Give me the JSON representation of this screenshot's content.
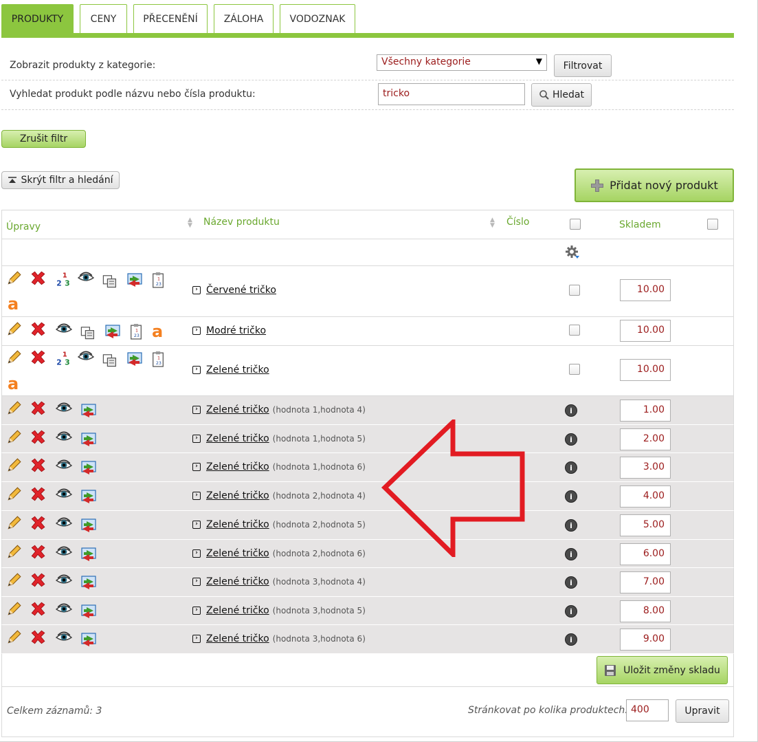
{
  "tabs": [
    {
      "label": "PRODUKTY",
      "active": true
    },
    {
      "label": "CENY",
      "active": false
    },
    {
      "label": "PŘECENĚNÍ",
      "active": false
    },
    {
      "label": "ZÁLOHA",
      "active": false
    },
    {
      "label": "VODOZNAK",
      "active": false
    }
  ],
  "filter": {
    "category_label": "Zobrazit produkty z kategorie:",
    "category_selected": "Všechny kategorie",
    "filter_button": "Filtrovat",
    "search_label": "Vyhledat produkt podle názvu nebo čísla produktu:",
    "search_value": "tricko",
    "search_button": "Hledat",
    "clear_button": "Zrušit filtr",
    "hide_button": "Skrýt filtr a hledání"
  },
  "add_product_button": "Přidat nový produkt",
  "table": {
    "headers": {
      "edits": "Úpravy",
      "name": "Název produktu",
      "number": "Číslo",
      "stock": "Skladem"
    },
    "rows": [
      {
        "name": "Červené tričko",
        "attr": "",
        "stock": "10.00",
        "variant": false
      },
      {
        "name": "Modré tričko",
        "attr": "",
        "stock": "10.00",
        "variant": false
      },
      {
        "name": "Zelené tričko",
        "attr": "",
        "stock": "10.00",
        "variant": false
      },
      {
        "name": "Zelené tričko",
        "attr": "(hodnota 1,hodnota 4)",
        "stock": "1.00",
        "variant": true
      },
      {
        "name": "Zelené tričko",
        "attr": "(hodnota 1,hodnota 5)",
        "stock": "2.00",
        "variant": true
      },
      {
        "name": "Zelené tričko",
        "attr": "(hodnota 1,hodnota 6)",
        "stock": "3.00",
        "variant": true
      },
      {
        "name": "Zelené tričko",
        "attr": "(hodnota 2,hodnota 4)",
        "stock": "4.00",
        "variant": true
      },
      {
        "name": "Zelené tričko",
        "attr": "(hodnota 2,hodnota 5)",
        "stock": "5.00",
        "variant": true
      },
      {
        "name": "Zelené tričko",
        "attr": "(hodnota 2,hodnota 6)",
        "stock": "6.00",
        "variant": true
      },
      {
        "name": "Zelené tričko",
        "attr": "(hodnota 3,hodnota 4)",
        "stock": "7.00",
        "variant": true
      },
      {
        "name": "Zelené tričko",
        "attr": "(hodnota 3,hodnota 5)",
        "stock": "8.00",
        "variant": true
      },
      {
        "name": "Zelené tričko",
        "attr": "(hodnota 3,hodnota 6)",
        "stock": "9.00",
        "variant": true
      }
    ],
    "save_button": "Uložit změny skladu"
  },
  "footer": {
    "total": "Celkem záznamů: 3",
    "per_page_label": "Stránkovat po kolika produktech:",
    "per_page_value": "400",
    "update_button": "Upravit"
  },
  "colors": {
    "accent": "#8cc63f",
    "link_green": "#6aa82f",
    "value_red": "#9b1b1b",
    "arrow": "#e21b22"
  },
  "icons": [
    "pencil-icon",
    "delete-icon",
    "numbering-icon",
    "eye-icon",
    "copy-icon",
    "transfer-icon",
    "clipboard-icon",
    "amazon-icon",
    "gear-icon",
    "info-icon",
    "search-icon",
    "plus-icon",
    "floppy-icon"
  ]
}
